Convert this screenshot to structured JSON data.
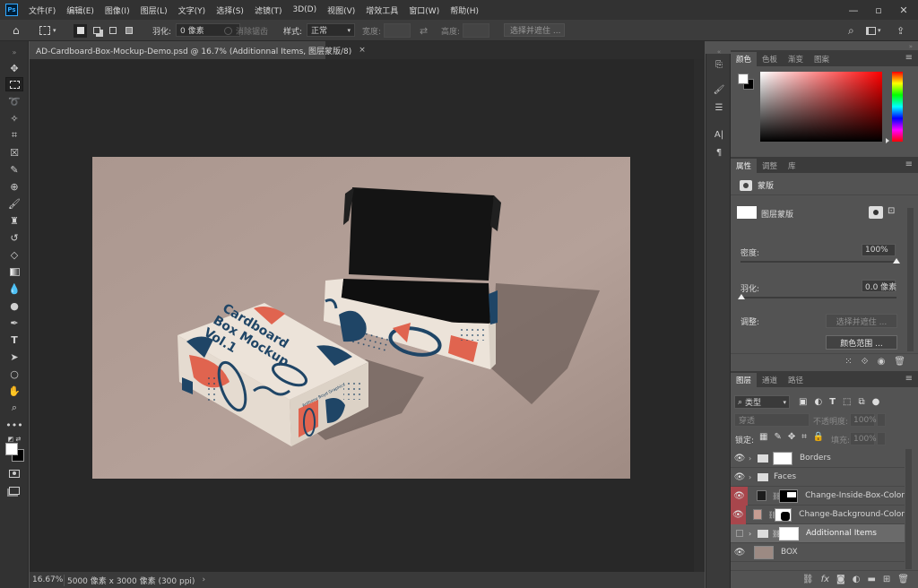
{
  "menubar": {
    "logo": "Ps",
    "items": [
      "文件(F)",
      "编辑(E)",
      "图像(I)",
      "图层(L)",
      "文字(Y)",
      "选择(S)",
      "滤镜(T)",
      "3D(D)",
      "视图(V)",
      "增效工具",
      "窗口(W)",
      "帮助(H)"
    ]
  },
  "options": {
    "feather_label": "羽化:",
    "feather_value": "0 像素",
    "antialias_label": "消除锯齿",
    "style_label": "样式:",
    "style_value": "正常",
    "width_label": "宽度:",
    "height_label": "高度:",
    "select_mask_button": "选择并遮住 ..."
  },
  "document": {
    "tab_title": "AD-Cardboard-Box-Mockup-Demo.psd @ 16.7% (Additionnal Items, 图层蒙版/8)",
    "close": "×"
  },
  "status": {
    "zoom": "16.67%",
    "info": "5000 像素 x 3000 像素 (300 ppi)",
    "arrow": "›"
  },
  "artwork": {
    "line1": "Cardboard",
    "line2": "Box Mockup",
    "line3": "Vol.1",
    "side_text": "Anthony Boyd Graphics"
  },
  "color_panel": {
    "tabs": [
      "颜色",
      "色板",
      "渐变",
      "图案"
    ]
  },
  "properties_panel": {
    "tabs": [
      "属性",
      "调整",
      "库"
    ],
    "mask_header": "蒙版",
    "layer_mask_label": "图层蒙版",
    "density_label": "密度:",
    "density_value": "100%",
    "feather_label": "羽化:",
    "feather_value": "0.0 像素",
    "adjust_label": "调整:",
    "select_mask_button": "选择并遮住 ...",
    "color_range_button": "颜色范围 ..."
  },
  "layers_panel": {
    "tabs": [
      "图层",
      "通道",
      "路径"
    ],
    "filter_kind": "类型",
    "blend_mode": "穿透",
    "opacity_label": "不透明度:",
    "opacity_value": "100%",
    "lock_label": "锁定:",
    "fill_label": "填充:",
    "fill_value": "100%",
    "layers": [
      {
        "name": "Borders",
        "kind": "group"
      },
      {
        "name": "Faces",
        "kind": "group"
      },
      {
        "name": "Change-Inside-Box-Color",
        "kind": "fill"
      },
      {
        "name": "Change-Background-Color",
        "kind": "fill"
      },
      {
        "name": "Additionnal Items",
        "kind": "group"
      },
      {
        "name": "BOX",
        "kind": "smart"
      }
    ]
  },
  "colors": {
    "app_bg": "#535353",
    "canvas_bg": "#282828",
    "artboard": "#b29e97",
    "box_front": "#ece3d9",
    "box_print_navy": "#1f4566",
    "box_print_red": "#e0644f",
    "box_inside": "#161616",
    "highlight_red": "#a8464c"
  }
}
